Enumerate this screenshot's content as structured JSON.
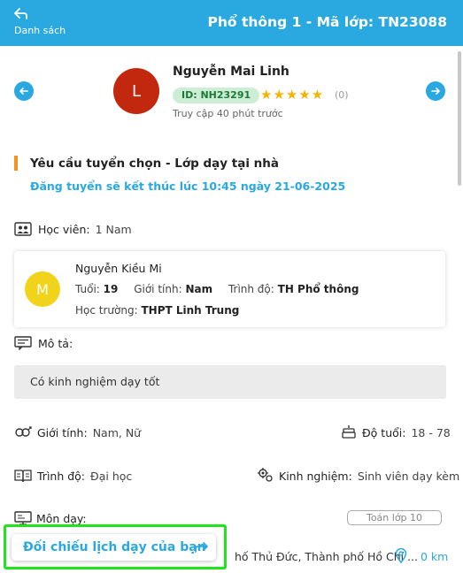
{
  "header": {
    "back_label": "Danh sách",
    "title": "Phổ thông 1 - Mã lớp: TN23088"
  },
  "tutor": {
    "initial": "L",
    "name": "Nguyễn Mai Linh",
    "id": "ID: NH23291",
    "stars": "★★★★★",
    "rating_count": "(0)",
    "last_access": "Truy cập 40 phút trước"
  },
  "request": {
    "title": "Yêu cầu tuyển chọn - Lớp dạy tại nhà",
    "deadline": "Đăng tuyển sẽ kết thúc lúc 10:45 ngày 21-06-2025"
  },
  "students": {
    "label": "Học viên:",
    "value": "1 Nam"
  },
  "student": {
    "initial": "M",
    "name": "Nguyễn Kiều Mi",
    "age_label": "Tuổi:",
    "age": "19",
    "gender_label": "Giới tính:",
    "gender": "Nam",
    "level_label": "Trình độ:",
    "level": "TH Phổ thông",
    "school_label": "Học trường:",
    "school": "THPT Linh Trung"
  },
  "description": {
    "label": "Mô tả:",
    "text": "Có kinh nghiệm dạy tốt"
  },
  "requirements": {
    "gender_label": "Giới tính:",
    "gender": "Nam, Nữ",
    "age_label": "Độ tuổi:",
    "age": "18 - 78",
    "education_label": "Trình độ:",
    "education": "Đại học",
    "experience_label": "Kinh nghiệm:",
    "experience": "Sinh viên dạy kèm"
  },
  "subjects": {
    "label": "Môn dạy:",
    "items": [
      "Toán lớp 10"
    ]
  },
  "address": {
    "text": "hố Thủ Đức, Thành phố Hồ Chí ...",
    "distance": "0 km"
  },
  "compare_button": {
    "label": "Đối chiếu lịch dạy của bạn"
  },
  "colors": {
    "primary": "#29a9e0",
    "accent_bar": "#f59221",
    "star": "#f5b301",
    "tutor_avatar": "#c1280d",
    "student_avatar": "#f2d31b",
    "highlight": "#22e41c"
  }
}
